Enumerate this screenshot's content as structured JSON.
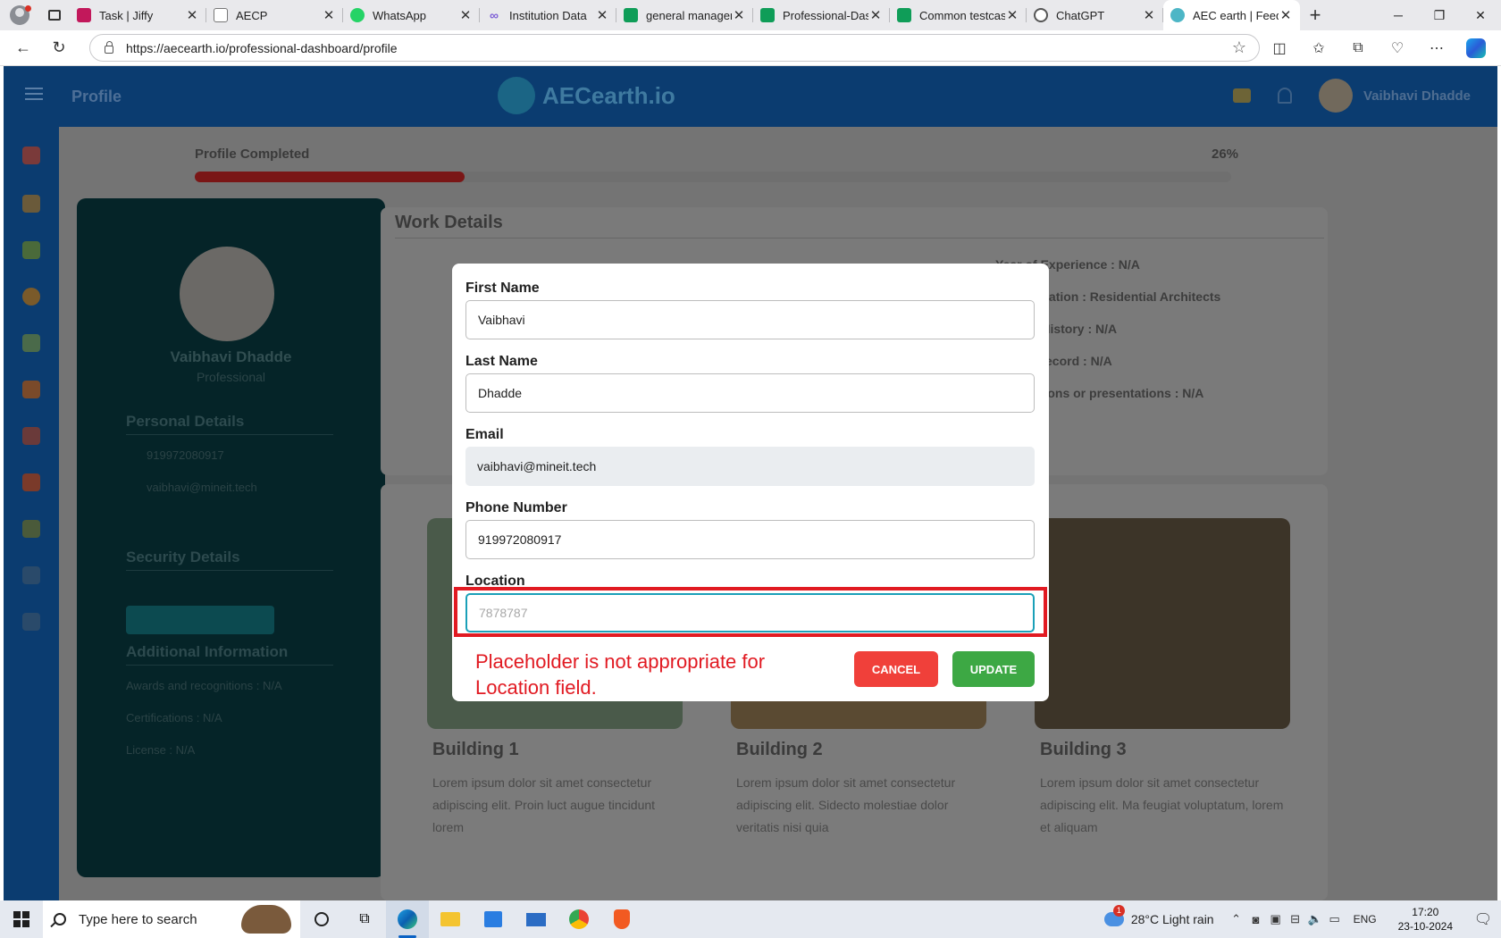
{
  "browser": {
    "tabs": [
      {
        "title": "Task | Jiffy",
        "favicon": "jiffy-icon",
        "color": "#c2185b"
      },
      {
        "title": "AECP",
        "favicon": "page-icon",
        "color": "#777777"
      },
      {
        "title": "WhatsApp",
        "favicon": "whatsapp-icon",
        "color": "#25d366"
      },
      {
        "title": "Institution Data",
        "favicon": "infinity-icon",
        "color": "#7b5cd6"
      },
      {
        "title": "general managem",
        "favicon": "sheets-icon",
        "color": "#0f9d58"
      },
      {
        "title": "Professional-Dash",
        "favicon": "sheets-icon",
        "color": "#0f9d58"
      },
      {
        "title": "Common testcase",
        "favicon": "sheets-icon",
        "color": "#0f9d58"
      },
      {
        "title": "ChatGPT",
        "favicon": "chatgpt-icon",
        "color": "#555555"
      },
      {
        "title": "AEC earth | Feed",
        "favicon": "aec-icon",
        "color": "#4db6c6",
        "active": true
      }
    ],
    "url": "https://aecearth.io/professional-dashboard/profile"
  },
  "app": {
    "header_title": "Profile",
    "logo_text": "AECearth.io",
    "user_name": "Vaibhavi Dhadde",
    "progress": {
      "label": "Profile Completed",
      "percent_text": "26%",
      "value": 0.26
    },
    "profile_card": {
      "name": "Vaibhavi Dhadde",
      "role": "Professional",
      "personal_title": "Personal Details",
      "phone": "919972080917",
      "email": "vaibhavi@mineit.tech",
      "security_title": "Security Details",
      "additional_title": "Additional Information",
      "awards": "Awards and recognitions : N/A",
      "certifications": "Certifications : N/A",
      "license": "License : N/A"
    },
    "work_details": {
      "title": "Work Details",
      "fields": [
        "Year of Experience : N/A",
        "Specialization : Residential Architects",
        "Project History : N/A",
        "Safety Record : N/A",
        "Publications or presentations : N/A"
      ]
    },
    "buildings": [
      {
        "title": "Building 1",
        "text": "Lorem ipsum dolor sit amet consectetur adipiscing elit. Proin luct augue tincidunt lorem"
      },
      {
        "title": "Building 2",
        "text": "Lorem ipsum dolor sit amet consectetur adipiscing elit. Sidecto molestiae dolor veritatis nisi quia"
      },
      {
        "title": "Building 3",
        "text": "Lorem ipsum dolor sit amet consectetur adipiscing elit. Ma feugiat voluptatum, lorem et aliquam"
      }
    ]
  },
  "modal": {
    "first_name": {
      "label": "First Name",
      "value": "Vaibhavi"
    },
    "last_name": {
      "label": "Last Name",
      "value": "Dhadde"
    },
    "email": {
      "label": "Email",
      "value": "vaibhavi@mineit.tech"
    },
    "phone": {
      "label": "Phone Number",
      "value": "919972080917"
    },
    "location": {
      "label": "Location",
      "value": "",
      "placeholder": "7878787"
    },
    "cancel_label": "CANCEL",
    "update_label": "UPDATE"
  },
  "annotation": {
    "text": "Placeholder is not appropriate for Location field.",
    "color": "#e11a22"
  },
  "taskbar": {
    "search_placeholder": "Type here to search",
    "weather": "28°C  Light rain",
    "weather_badge": "1",
    "language": "ENG",
    "time": "17:20",
    "date": "23-10-2024"
  }
}
